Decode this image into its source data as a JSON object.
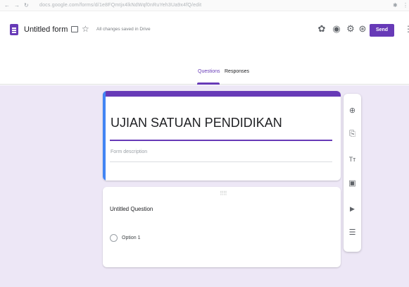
{
  "browser": {
    "back": "←",
    "forward": "→",
    "reload": "↻",
    "url": "docs.google.com/forms/d/1e8FQmtjx4lkNdWqf0nRuYeh3Ua9x4fQ/edit",
    "menu": "⋮"
  },
  "header": {
    "title": "Untitled form",
    "save_status": "All changes saved in Drive",
    "star": "☆",
    "send_label": "Send",
    "more": "⋮",
    "icons": [
      "palette-icon",
      "preview-icon",
      "settings-icon"
    ]
  },
  "tabs": [
    {
      "label": "Questions",
      "active": true
    },
    {
      "label": "Responses",
      "active": false
    }
  ],
  "form": {
    "heading": "UJIAN SATUAN PENDIDIKAN",
    "description_placeholder": "Form description"
  },
  "question": {
    "title": "Untitled Question",
    "options": [
      "Option 1"
    ]
  },
  "toolbar": {
    "add_question": "⊕",
    "import_questions": "⎘",
    "add_title": "Tт",
    "add_image": "▣",
    "add_video": "▶",
    "add_section": "☰"
  },
  "colors": {
    "accent": "#673ab7",
    "canvas": "#ede7f6",
    "focus_band": "#4285f4"
  }
}
